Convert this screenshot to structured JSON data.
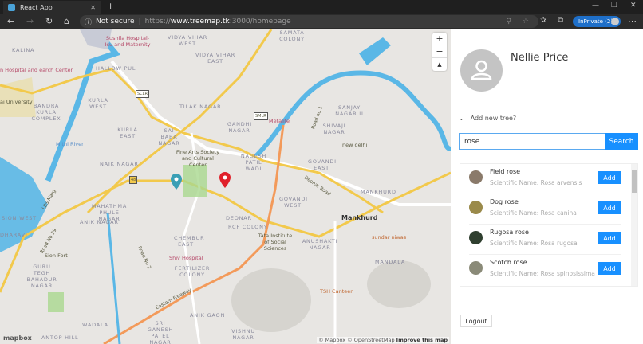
{
  "browser": {
    "tab_title": "React App",
    "security": "Not secure",
    "url_prefix": "https://",
    "url_host": "www.treemap.tk",
    "url_rest": ":3000/homepage",
    "inprivate": "InPrivate (2)"
  },
  "map": {
    "labels": [
      "Kalina",
      "Sushila Hospital-Icu and Maternity",
      "Vidya Vihar West",
      "Vidya Vihar East",
      "Hallow Pul",
      "Bandra Kurla Complex",
      "Kurla West",
      "Kurla East",
      "Mithi River",
      "Tilak Nagar",
      "Sai Baba Nagar",
      "Fine Arts Society and Cultural Center",
      "Naik Nagar",
      "Gandhi Nagar",
      "Nagesh Patil Wadi",
      "Samata Colony",
      "Metalife",
      "Sanjay Nagar II",
      "Shivaji Nagar",
      "new delhi",
      "Govandi East",
      "Govandi West",
      "Mankhurd",
      "Mankhurd",
      "Deonar",
      "RCF Colony",
      "Tata Institute of Social Sciences",
      "Anushakti Nagar",
      "sundar niwas",
      "Mandala",
      "TSH Canteen",
      "Mahathma Phule Nagar",
      "Anik Nagar",
      "Sion West",
      "Dharavi",
      "Sion Fort",
      "Chembur East",
      "Shiv Hospital",
      "Fertilizer Colony",
      "Guru Tegh Bahadur Nagar",
      "Anik Gaon",
      "Wadala",
      "Sri Ganesh Patel Nagar",
      "Antop Hill",
      "Vishnu Nagar",
      "Eastern Freeway",
      "Deonar Road",
      "Road No 2",
      "LBS Marg",
      "Road No 29",
      "Road no 1",
      "SCLR",
      "SMLR",
      "48",
      "n Hospital and earch Center",
      "ai University"
    ],
    "zoom_in": "+",
    "zoom_out": "−",
    "compass": "▲",
    "attribution": "© Mapbox © OpenStreetMap",
    "improve": "Improve this map",
    "logo": "mapbox",
    "markers": [
      {
        "color": "#3a9fb5"
      },
      {
        "color": "#e0202a"
      }
    ]
  },
  "panel": {
    "user_name": "Nellie Price",
    "add_new_label": "Add new tree?",
    "search": {
      "value": "rose",
      "button": "Search"
    },
    "results": [
      {
        "name": "Field rose",
        "scientific": "Scientific Name: Rosa arvensis",
        "add": "Add",
        "thumb": "#8a7a6a"
      },
      {
        "name": "Dog rose",
        "scientific": "Scientific Name: Rosa canina",
        "add": "Add",
        "thumb": "#9a8a4a"
      },
      {
        "name": "Rugosa rose",
        "scientific": "Scientific Name: Rosa rugosa",
        "add": "Add",
        "thumb": "#2f3f2f"
      },
      {
        "name": "Scotch rose",
        "scientific": "Scientific Name: Rosa spinosissima",
        "add": "Add",
        "thumb": "#8a8a78"
      }
    ],
    "logout": "Logout"
  },
  "colors": {
    "accent": "#1890ff",
    "road_major": "#f2c94c",
    "freeway": "#f39a5a",
    "water": "#5ab7e6"
  }
}
